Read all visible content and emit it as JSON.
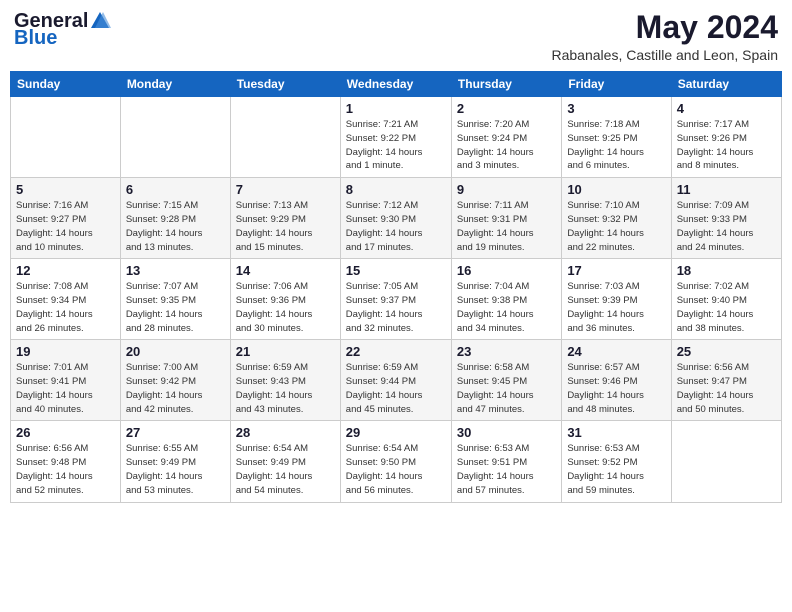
{
  "header": {
    "logo_general": "General",
    "logo_blue": "Blue",
    "month": "May 2024",
    "location": "Rabanales, Castille and Leon, Spain"
  },
  "days_of_week": [
    "Sunday",
    "Monday",
    "Tuesday",
    "Wednesday",
    "Thursday",
    "Friday",
    "Saturday"
  ],
  "weeks": [
    {
      "days": [
        {
          "num": "",
          "info": ""
        },
        {
          "num": "",
          "info": ""
        },
        {
          "num": "",
          "info": ""
        },
        {
          "num": "1",
          "info": "Sunrise: 7:21 AM\nSunset: 9:22 PM\nDaylight: 14 hours\nand 1 minute."
        },
        {
          "num": "2",
          "info": "Sunrise: 7:20 AM\nSunset: 9:24 PM\nDaylight: 14 hours\nand 3 minutes."
        },
        {
          "num": "3",
          "info": "Sunrise: 7:18 AM\nSunset: 9:25 PM\nDaylight: 14 hours\nand 6 minutes."
        },
        {
          "num": "4",
          "info": "Sunrise: 7:17 AM\nSunset: 9:26 PM\nDaylight: 14 hours\nand 8 minutes."
        }
      ]
    },
    {
      "days": [
        {
          "num": "5",
          "info": "Sunrise: 7:16 AM\nSunset: 9:27 PM\nDaylight: 14 hours\nand 10 minutes."
        },
        {
          "num": "6",
          "info": "Sunrise: 7:15 AM\nSunset: 9:28 PM\nDaylight: 14 hours\nand 13 minutes."
        },
        {
          "num": "7",
          "info": "Sunrise: 7:13 AM\nSunset: 9:29 PM\nDaylight: 14 hours\nand 15 minutes."
        },
        {
          "num": "8",
          "info": "Sunrise: 7:12 AM\nSunset: 9:30 PM\nDaylight: 14 hours\nand 17 minutes."
        },
        {
          "num": "9",
          "info": "Sunrise: 7:11 AM\nSunset: 9:31 PM\nDaylight: 14 hours\nand 19 minutes."
        },
        {
          "num": "10",
          "info": "Sunrise: 7:10 AM\nSunset: 9:32 PM\nDaylight: 14 hours\nand 22 minutes."
        },
        {
          "num": "11",
          "info": "Sunrise: 7:09 AM\nSunset: 9:33 PM\nDaylight: 14 hours\nand 24 minutes."
        }
      ]
    },
    {
      "days": [
        {
          "num": "12",
          "info": "Sunrise: 7:08 AM\nSunset: 9:34 PM\nDaylight: 14 hours\nand 26 minutes."
        },
        {
          "num": "13",
          "info": "Sunrise: 7:07 AM\nSunset: 9:35 PM\nDaylight: 14 hours\nand 28 minutes."
        },
        {
          "num": "14",
          "info": "Sunrise: 7:06 AM\nSunset: 9:36 PM\nDaylight: 14 hours\nand 30 minutes."
        },
        {
          "num": "15",
          "info": "Sunrise: 7:05 AM\nSunset: 9:37 PM\nDaylight: 14 hours\nand 32 minutes."
        },
        {
          "num": "16",
          "info": "Sunrise: 7:04 AM\nSunset: 9:38 PM\nDaylight: 14 hours\nand 34 minutes."
        },
        {
          "num": "17",
          "info": "Sunrise: 7:03 AM\nSunset: 9:39 PM\nDaylight: 14 hours\nand 36 minutes."
        },
        {
          "num": "18",
          "info": "Sunrise: 7:02 AM\nSunset: 9:40 PM\nDaylight: 14 hours\nand 38 minutes."
        }
      ]
    },
    {
      "days": [
        {
          "num": "19",
          "info": "Sunrise: 7:01 AM\nSunset: 9:41 PM\nDaylight: 14 hours\nand 40 minutes."
        },
        {
          "num": "20",
          "info": "Sunrise: 7:00 AM\nSunset: 9:42 PM\nDaylight: 14 hours\nand 42 minutes."
        },
        {
          "num": "21",
          "info": "Sunrise: 6:59 AM\nSunset: 9:43 PM\nDaylight: 14 hours\nand 43 minutes."
        },
        {
          "num": "22",
          "info": "Sunrise: 6:59 AM\nSunset: 9:44 PM\nDaylight: 14 hours\nand 45 minutes."
        },
        {
          "num": "23",
          "info": "Sunrise: 6:58 AM\nSunset: 9:45 PM\nDaylight: 14 hours\nand 47 minutes."
        },
        {
          "num": "24",
          "info": "Sunrise: 6:57 AM\nSunset: 9:46 PM\nDaylight: 14 hours\nand 48 minutes."
        },
        {
          "num": "25",
          "info": "Sunrise: 6:56 AM\nSunset: 9:47 PM\nDaylight: 14 hours\nand 50 minutes."
        }
      ]
    },
    {
      "days": [
        {
          "num": "26",
          "info": "Sunrise: 6:56 AM\nSunset: 9:48 PM\nDaylight: 14 hours\nand 52 minutes."
        },
        {
          "num": "27",
          "info": "Sunrise: 6:55 AM\nSunset: 9:49 PM\nDaylight: 14 hours\nand 53 minutes."
        },
        {
          "num": "28",
          "info": "Sunrise: 6:54 AM\nSunset: 9:49 PM\nDaylight: 14 hours\nand 54 minutes."
        },
        {
          "num": "29",
          "info": "Sunrise: 6:54 AM\nSunset: 9:50 PM\nDaylight: 14 hours\nand 56 minutes."
        },
        {
          "num": "30",
          "info": "Sunrise: 6:53 AM\nSunset: 9:51 PM\nDaylight: 14 hours\nand 57 minutes."
        },
        {
          "num": "31",
          "info": "Sunrise: 6:53 AM\nSunset: 9:52 PM\nDaylight: 14 hours\nand 59 minutes."
        },
        {
          "num": "",
          "info": ""
        }
      ]
    }
  ]
}
